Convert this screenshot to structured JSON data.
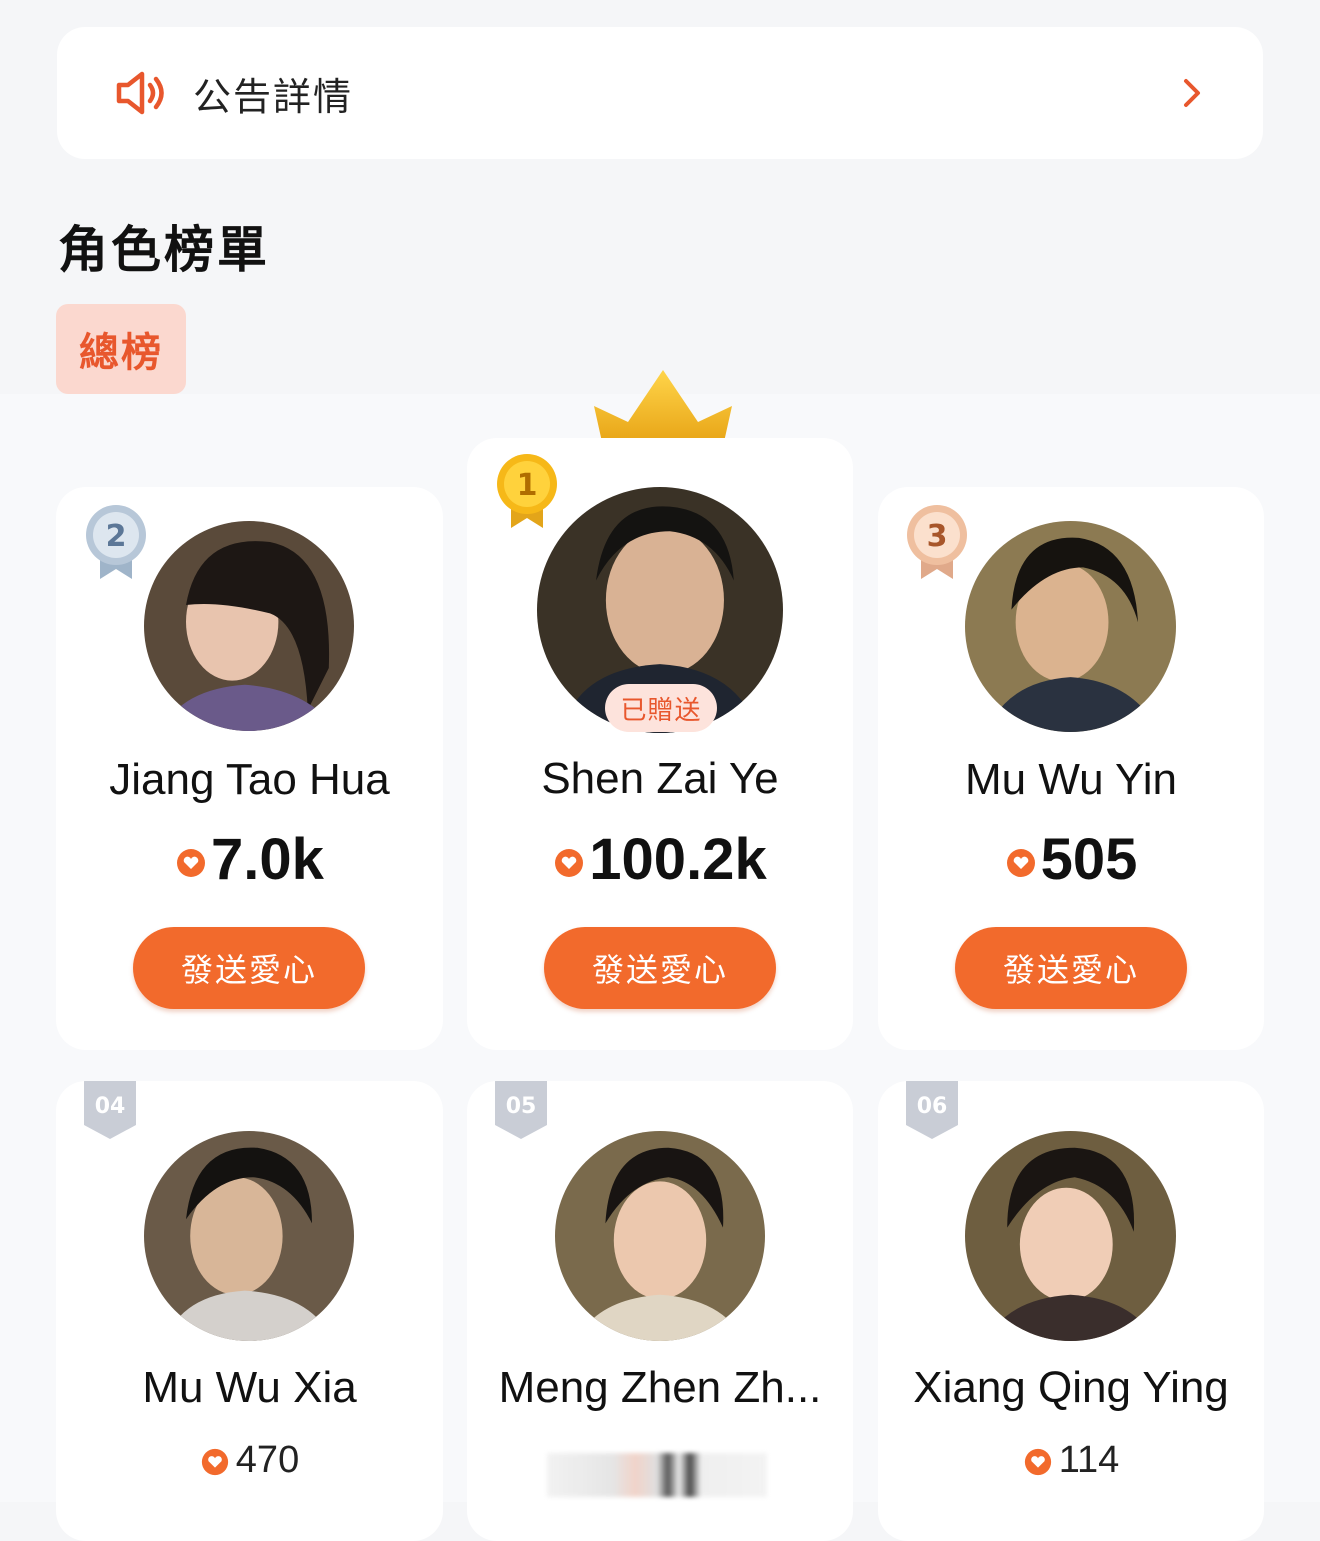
{
  "notice": {
    "title": "公告詳情",
    "icon": "speaker-icon",
    "chevron_icon": "chevron-right-icon"
  },
  "section_title": "角色榜單",
  "tab": {
    "label": "總榜",
    "active": true
  },
  "gifted_label": "已贈送",
  "send_label": "發送愛心",
  "accent": "#f26a2c",
  "ranking": [
    {
      "rank": "1",
      "name": "Shen Zai Ye",
      "votes": "100.2k",
      "medal": "gold-medal-icon",
      "gifted": true
    },
    {
      "rank": "2",
      "name": "Jiang Tao Hua",
      "votes": "7.0k",
      "medal": "silver-medal-icon"
    },
    {
      "rank": "3",
      "name": "Mu Wu Yin",
      "votes": "505",
      "medal": "bronze-medal-icon"
    },
    {
      "rank": "04",
      "name": "Mu Wu Xia",
      "votes": "470"
    },
    {
      "rank": "05",
      "name": "Meng Zhen Zh...",
      "votes": ""
    },
    {
      "rank": "06",
      "name": "Xiang Qing Ying",
      "votes": "114"
    }
  ]
}
